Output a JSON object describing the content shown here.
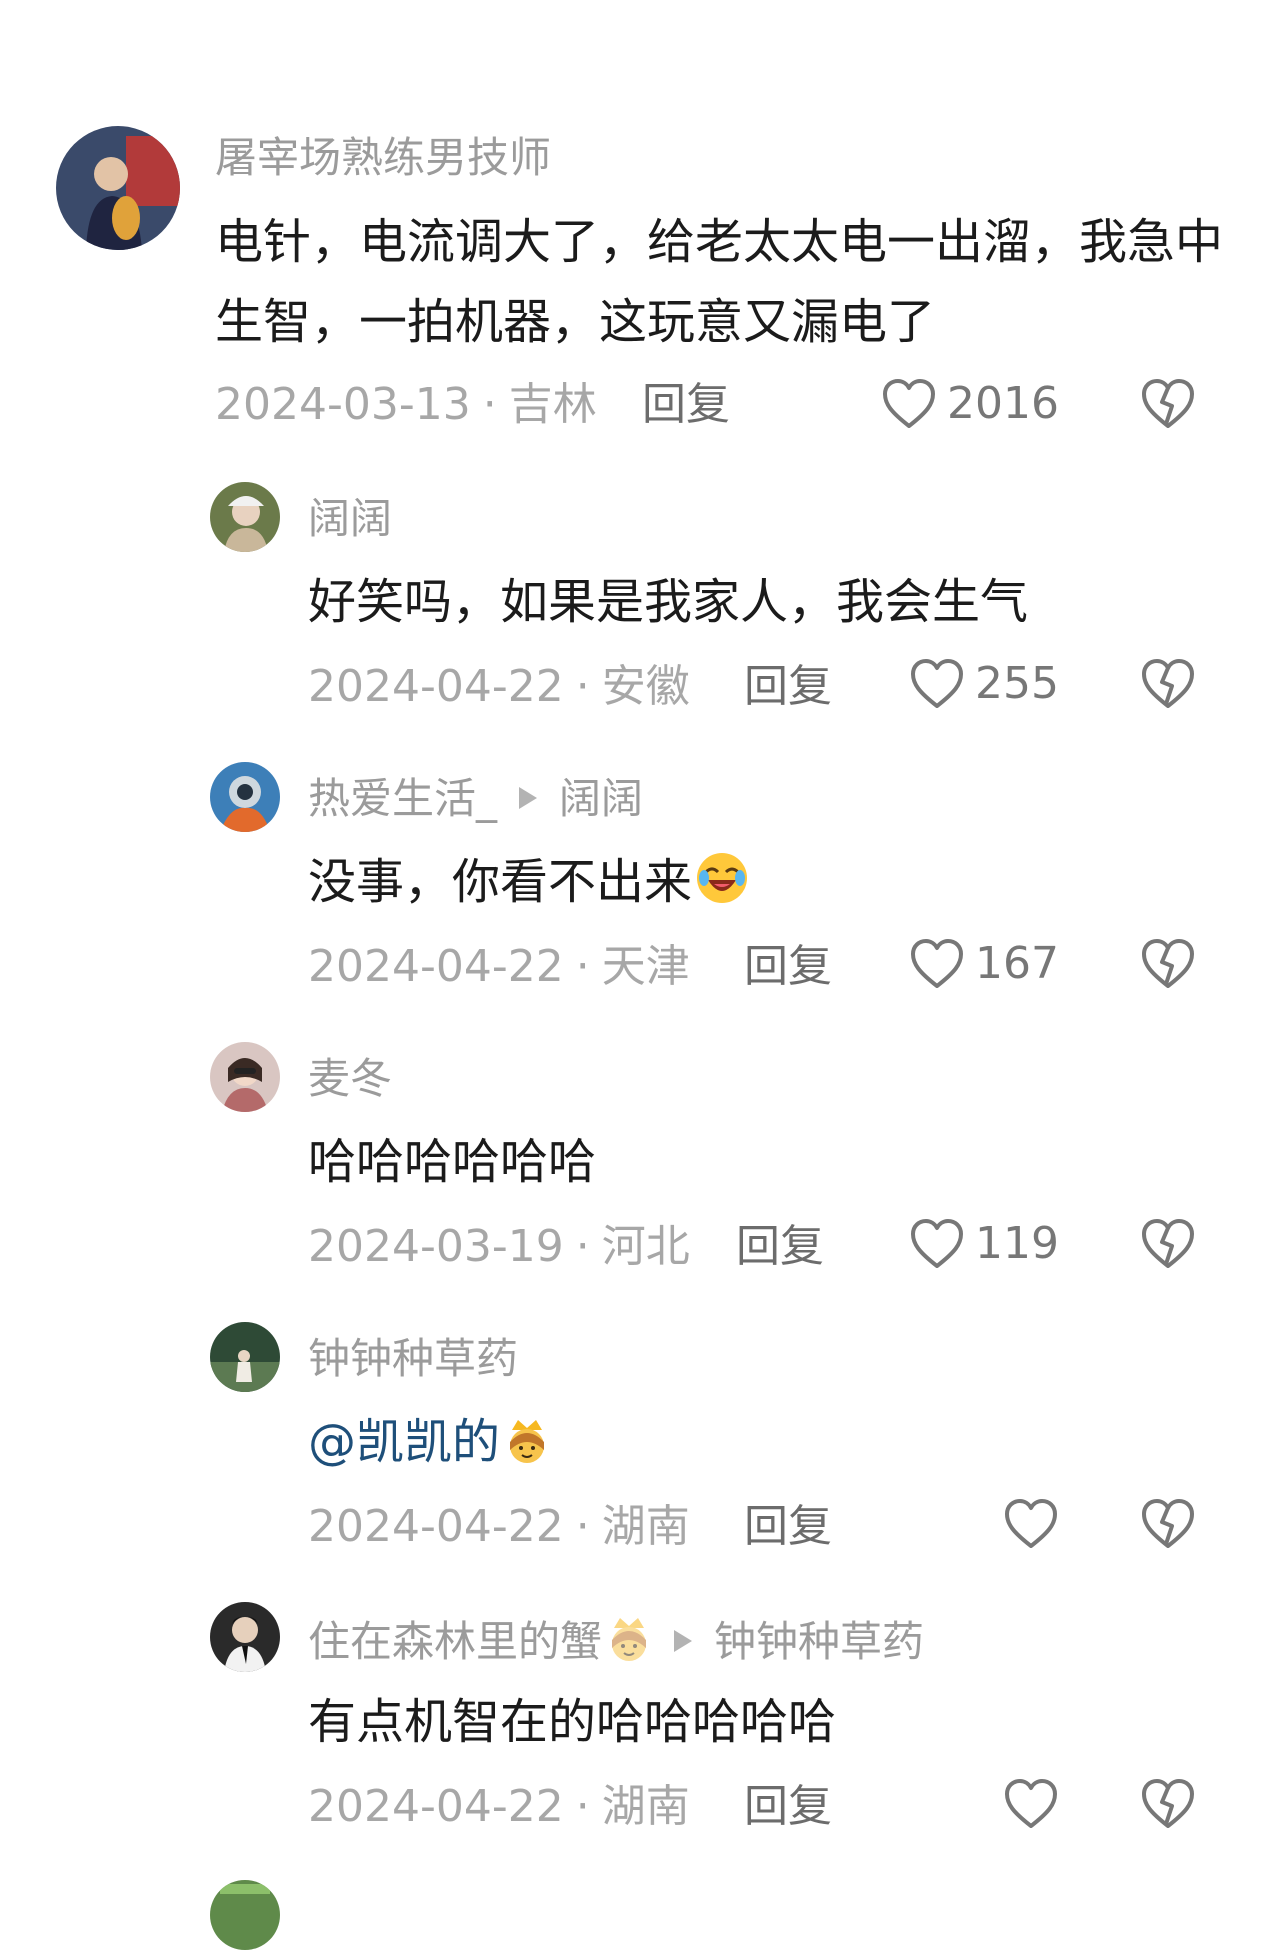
{
  "comments": [
    {
      "username": "屠宰场熟练男技师",
      "text": "电针，电流调大了，给老太太电一出溜，我急中生智，一拍机器，这玩意又漏电了",
      "date": "2024-03-13",
      "location": "吉林",
      "reply_label": "回复",
      "likes": "2016"
    },
    {
      "username": "阔阔",
      "text": "好笑吗，如果是我家人，我会生气",
      "date": "2024-04-22",
      "location": "安徽",
      "reply_label": "回复",
      "likes": "255"
    },
    {
      "username": "热爱生活_",
      "reply_to": "阔阔",
      "text": "没事，你看不出来",
      "date": "2024-04-22",
      "location": "天津",
      "reply_label": "回复",
      "likes": "167"
    },
    {
      "username": "麦冬",
      "text": "哈哈哈哈哈哈",
      "date": "2024-03-19",
      "location": "河北",
      "reply_label": "回复",
      "likes": "119"
    },
    {
      "username": "钟钟种草药",
      "text": "@凯凯的",
      "date": "2024-04-22",
      "location": "湖南",
      "reply_label": "回复",
      "likes": ""
    },
    {
      "username": "住在森林里的蟹",
      "reply_to": "钟钟种草药",
      "text": "有点机智在的哈哈哈哈哈",
      "date": "2024-04-22",
      "location": "湖南",
      "reply_label": "回复",
      "likes": ""
    }
  ],
  "separator": "·",
  "icons": {
    "like": "heart-outline-icon",
    "dislike": "broken-heart-icon",
    "reply_arrow": "reply-arrow-icon",
    "laughing_emoji": "rolling-laughing-emoji",
    "princess_emoji": "princess-emoji"
  },
  "colors": {
    "username": "#9b9b9b",
    "text": "#1b1b1b",
    "meta": "#a7a7a7",
    "mention": "#1e4f7a"
  }
}
